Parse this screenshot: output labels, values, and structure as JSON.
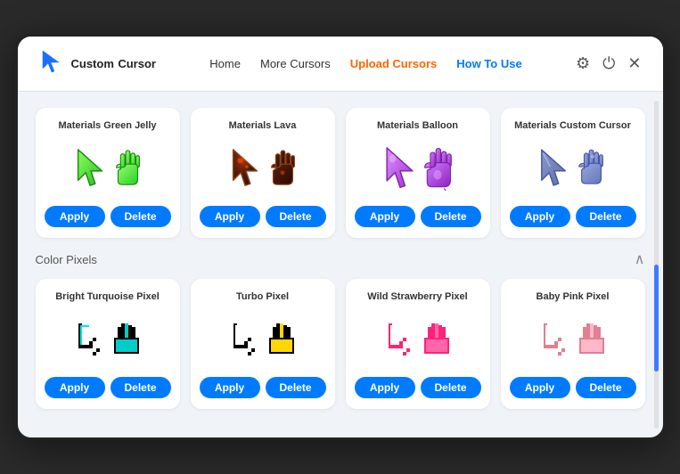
{
  "header": {
    "logo_text_line1": "Custom",
    "logo_text_line2": "Cursor",
    "nav": [
      {
        "label": "Home",
        "id": "home",
        "class": "normal"
      },
      {
        "label": "More Cursors",
        "id": "more-cursors",
        "class": "normal"
      },
      {
        "label": "Upload Cursors",
        "id": "upload-cursors",
        "class": "orange"
      },
      {
        "label": "How To Use",
        "id": "how-to-use",
        "class": "active"
      }
    ],
    "icons": {
      "gear": "⚙",
      "power": "⏻",
      "close": "✕"
    }
  },
  "sections": [
    {
      "id": "materials",
      "title": "",
      "collapsible": false,
      "cards": [
        {
          "title": "Materials Green Jelly",
          "type": "green-jelly"
        },
        {
          "title": "Materials Lava",
          "type": "lava"
        },
        {
          "title": "Materials Balloon",
          "type": "balloon"
        },
        {
          "title": "Materials Custom Cursor",
          "type": "custom-cursor"
        }
      ]
    },
    {
      "id": "color-pixels",
      "title": "Color Pixels",
      "collapsible": true,
      "cards": [
        {
          "title": "Bright Turquoise Pixel",
          "type": "turquoise-pixel"
        },
        {
          "title": "Turbo Pixel",
          "type": "turbo-pixel"
        },
        {
          "title": "Wild Strawberry Pixel",
          "type": "strawberry-pixel"
        },
        {
          "title": "Baby Pink Pixel",
          "type": "pink-pixel"
        }
      ]
    }
  ],
  "buttons": {
    "apply": "Apply",
    "delete": "Delete"
  }
}
